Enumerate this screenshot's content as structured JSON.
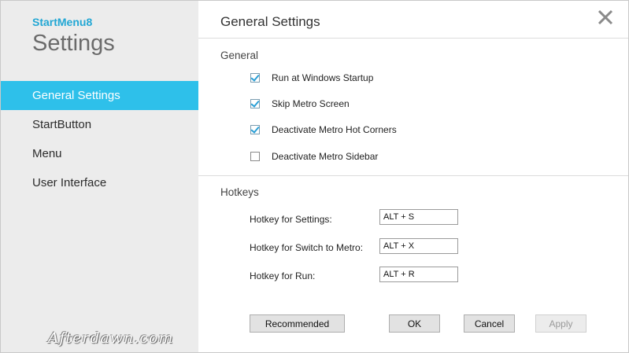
{
  "sidebar": {
    "app_name": "StartMenu8",
    "title": "Settings",
    "items": [
      {
        "label": "General Settings",
        "active": true
      },
      {
        "label": "StartButton",
        "active": false
      },
      {
        "label": "Menu",
        "active": false
      },
      {
        "label": "User Interface",
        "active": false
      }
    ],
    "watermark": "Afterdawn.com"
  },
  "main": {
    "title": "General Settings",
    "close_icon": "close-icon",
    "general": {
      "heading": "General",
      "options": [
        {
          "label": "Run at Windows Startup",
          "checked": true
        },
        {
          "label": "Skip Metro Screen",
          "checked": true
        },
        {
          "label": "Deactivate Metro Hot Corners",
          "checked": true
        },
        {
          "label": "Deactivate Metro Sidebar",
          "checked": false
        }
      ]
    },
    "hotkeys": {
      "heading": "Hotkeys",
      "items": [
        {
          "label": "Hotkey for Settings:",
          "value": "ALT + S"
        },
        {
          "label": "Hotkey for Switch to Metro:",
          "value": "ALT + X"
        },
        {
          "label": "Hotkey for Run:",
          "value": "ALT + R"
        }
      ]
    },
    "buttons": {
      "recommended": "Recommended",
      "ok": "OK",
      "cancel": "Cancel",
      "apply": "Apply"
    }
  },
  "colors": {
    "accent": "#2ec0ea",
    "app_name": "#22a7d4",
    "sidebar_bg": "#ececec"
  }
}
